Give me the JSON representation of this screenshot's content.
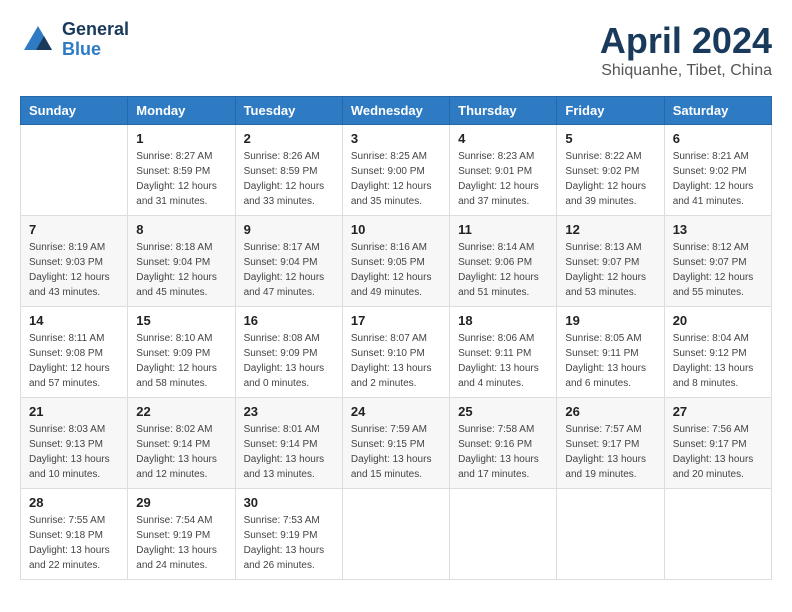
{
  "header": {
    "logo_line1": "General",
    "logo_line2": "Blue",
    "month": "April 2024",
    "location": "Shiquanhe, Tibet, China"
  },
  "weekdays": [
    "Sunday",
    "Monday",
    "Tuesday",
    "Wednesday",
    "Thursday",
    "Friday",
    "Saturday"
  ],
  "weeks": [
    [
      {
        "day": "",
        "sunrise": "",
        "sunset": "",
        "daylight": ""
      },
      {
        "day": "1",
        "sunrise": "Sunrise: 8:27 AM",
        "sunset": "Sunset: 8:59 PM",
        "daylight": "Daylight: 12 hours and 31 minutes."
      },
      {
        "day": "2",
        "sunrise": "Sunrise: 8:26 AM",
        "sunset": "Sunset: 8:59 PM",
        "daylight": "Daylight: 12 hours and 33 minutes."
      },
      {
        "day": "3",
        "sunrise": "Sunrise: 8:25 AM",
        "sunset": "Sunset: 9:00 PM",
        "daylight": "Daylight: 12 hours and 35 minutes."
      },
      {
        "day": "4",
        "sunrise": "Sunrise: 8:23 AM",
        "sunset": "Sunset: 9:01 PM",
        "daylight": "Daylight: 12 hours and 37 minutes."
      },
      {
        "day": "5",
        "sunrise": "Sunrise: 8:22 AM",
        "sunset": "Sunset: 9:02 PM",
        "daylight": "Daylight: 12 hours and 39 minutes."
      },
      {
        "day": "6",
        "sunrise": "Sunrise: 8:21 AM",
        "sunset": "Sunset: 9:02 PM",
        "daylight": "Daylight: 12 hours and 41 minutes."
      }
    ],
    [
      {
        "day": "7",
        "sunrise": "Sunrise: 8:19 AM",
        "sunset": "Sunset: 9:03 PM",
        "daylight": "Daylight: 12 hours and 43 minutes."
      },
      {
        "day": "8",
        "sunrise": "Sunrise: 8:18 AM",
        "sunset": "Sunset: 9:04 PM",
        "daylight": "Daylight: 12 hours and 45 minutes."
      },
      {
        "day": "9",
        "sunrise": "Sunrise: 8:17 AM",
        "sunset": "Sunset: 9:04 PM",
        "daylight": "Daylight: 12 hours and 47 minutes."
      },
      {
        "day": "10",
        "sunrise": "Sunrise: 8:16 AM",
        "sunset": "Sunset: 9:05 PM",
        "daylight": "Daylight: 12 hours and 49 minutes."
      },
      {
        "day": "11",
        "sunrise": "Sunrise: 8:14 AM",
        "sunset": "Sunset: 9:06 PM",
        "daylight": "Daylight: 12 hours and 51 minutes."
      },
      {
        "day": "12",
        "sunrise": "Sunrise: 8:13 AM",
        "sunset": "Sunset: 9:07 PM",
        "daylight": "Daylight: 12 hours and 53 minutes."
      },
      {
        "day": "13",
        "sunrise": "Sunrise: 8:12 AM",
        "sunset": "Sunset: 9:07 PM",
        "daylight": "Daylight: 12 hours and 55 minutes."
      }
    ],
    [
      {
        "day": "14",
        "sunrise": "Sunrise: 8:11 AM",
        "sunset": "Sunset: 9:08 PM",
        "daylight": "Daylight: 12 hours and 57 minutes."
      },
      {
        "day": "15",
        "sunrise": "Sunrise: 8:10 AM",
        "sunset": "Sunset: 9:09 PM",
        "daylight": "Daylight: 12 hours and 58 minutes."
      },
      {
        "day": "16",
        "sunrise": "Sunrise: 8:08 AM",
        "sunset": "Sunset: 9:09 PM",
        "daylight": "Daylight: 13 hours and 0 minutes."
      },
      {
        "day": "17",
        "sunrise": "Sunrise: 8:07 AM",
        "sunset": "Sunset: 9:10 PM",
        "daylight": "Daylight: 13 hours and 2 minutes."
      },
      {
        "day": "18",
        "sunrise": "Sunrise: 8:06 AM",
        "sunset": "Sunset: 9:11 PM",
        "daylight": "Daylight: 13 hours and 4 minutes."
      },
      {
        "day": "19",
        "sunrise": "Sunrise: 8:05 AM",
        "sunset": "Sunset: 9:11 PM",
        "daylight": "Daylight: 13 hours and 6 minutes."
      },
      {
        "day": "20",
        "sunrise": "Sunrise: 8:04 AM",
        "sunset": "Sunset: 9:12 PM",
        "daylight": "Daylight: 13 hours and 8 minutes."
      }
    ],
    [
      {
        "day": "21",
        "sunrise": "Sunrise: 8:03 AM",
        "sunset": "Sunset: 9:13 PM",
        "daylight": "Daylight: 13 hours and 10 minutes."
      },
      {
        "day": "22",
        "sunrise": "Sunrise: 8:02 AM",
        "sunset": "Sunset: 9:14 PM",
        "daylight": "Daylight: 13 hours and 12 minutes."
      },
      {
        "day": "23",
        "sunrise": "Sunrise: 8:01 AM",
        "sunset": "Sunset: 9:14 PM",
        "daylight": "Daylight: 13 hours and 13 minutes."
      },
      {
        "day": "24",
        "sunrise": "Sunrise: 7:59 AM",
        "sunset": "Sunset: 9:15 PM",
        "daylight": "Daylight: 13 hours and 15 minutes."
      },
      {
        "day": "25",
        "sunrise": "Sunrise: 7:58 AM",
        "sunset": "Sunset: 9:16 PM",
        "daylight": "Daylight: 13 hours and 17 minutes."
      },
      {
        "day": "26",
        "sunrise": "Sunrise: 7:57 AM",
        "sunset": "Sunset: 9:17 PM",
        "daylight": "Daylight: 13 hours and 19 minutes."
      },
      {
        "day": "27",
        "sunrise": "Sunrise: 7:56 AM",
        "sunset": "Sunset: 9:17 PM",
        "daylight": "Daylight: 13 hours and 20 minutes."
      }
    ],
    [
      {
        "day": "28",
        "sunrise": "Sunrise: 7:55 AM",
        "sunset": "Sunset: 9:18 PM",
        "daylight": "Daylight: 13 hours and 22 minutes."
      },
      {
        "day": "29",
        "sunrise": "Sunrise: 7:54 AM",
        "sunset": "Sunset: 9:19 PM",
        "daylight": "Daylight: 13 hours and 24 minutes."
      },
      {
        "day": "30",
        "sunrise": "Sunrise: 7:53 AM",
        "sunset": "Sunset: 9:19 PM",
        "daylight": "Daylight: 13 hours and 26 minutes."
      },
      {
        "day": "",
        "sunrise": "",
        "sunset": "",
        "daylight": ""
      },
      {
        "day": "",
        "sunrise": "",
        "sunset": "",
        "daylight": ""
      },
      {
        "day": "",
        "sunrise": "",
        "sunset": "",
        "daylight": ""
      },
      {
        "day": "",
        "sunrise": "",
        "sunset": "",
        "daylight": ""
      }
    ]
  ]
}
